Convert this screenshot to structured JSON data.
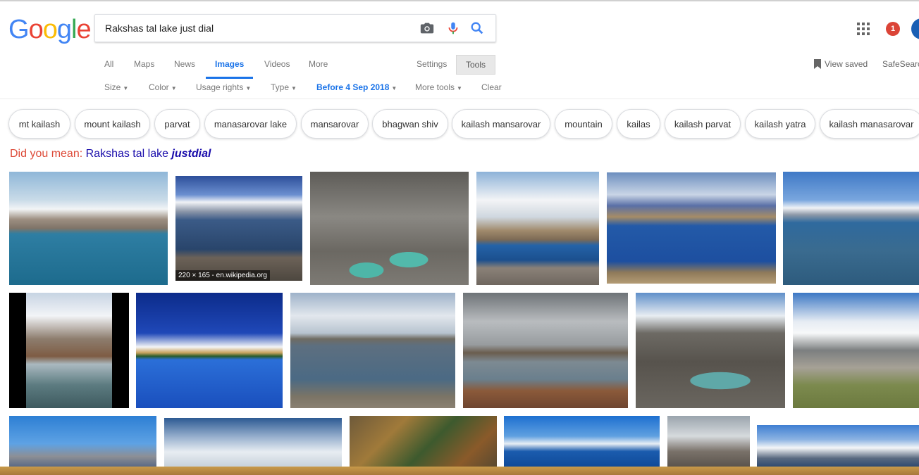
{
  "logo": {
    "letters": [
      "G",
      "o",
      "o",
      "g",
      "l",
      "e"
    ],
    "colors": [
      "#4285f4",
      "#ea4335",
      "#fbbc05",
      "#4285f4",
      "#34a853",
      "#ea4335"
    ]
  },
  "search": {
    "query": "Rakshas tal lake just dial"
  },
  "icons": {
    "camera": "camera-icon",
    "mic": "microphone-icon",
    "search": "search-icon",
    "apps": "apps-grid-icon",
    "bookmark": "bookmark-icon"
  },
  "header": {
    "notifications": "1"
  },
  "tabs": [
    {
      "label": "All"
    },
    {
      "label": "Maps"
    },
    {
      "label": "News"
    },
    {
      "label": "Images"
    },
    {
      "label": "Videos"
    },
    {
      "label": "More"
    },
    {
      "label": "Settings"
    },
    {
      "label": "Tools"
    }
  ],
  "view_saved": "View saved",
  "safesearch": "SafeSearch",
  "filters": [
    {
      "label": "Size"
    },
    {
      "label": "Color"
    },
    {
      "label": "Usage rights"
    },
    {
      "label": "Type"
    },
    {
      "label": "Before 4 Sep 2018"
    },
    {
      "label": "More tools"
    },
    {
      "label": "Clear"
    }
  ],
  "chips": [
    "mt kailash",
    "mount kailash",
    "parvat",
    "manasarovar lake",
    "mansarovar",
    "bhagwan shiv",
    "kailash mansarovar",
    "mountain",
    "kailas",
    "kailash parvat",
    "kailash yatra",
    "kailash manasarovar"
  ],
  "did_you_mean": {
    "prefix": "Did you mean: ",
    "text": "Rakshas tal lake ",
    "bold": "justdial"
  },
  "results": {
    "caption": "220 × 165 - en.wikipedia.org"
  },
  "colors": {
    "accent": "#1a73e8",
    "dym_red": "#dd4b39",
    "link": "#1a0dab"
  }
}
